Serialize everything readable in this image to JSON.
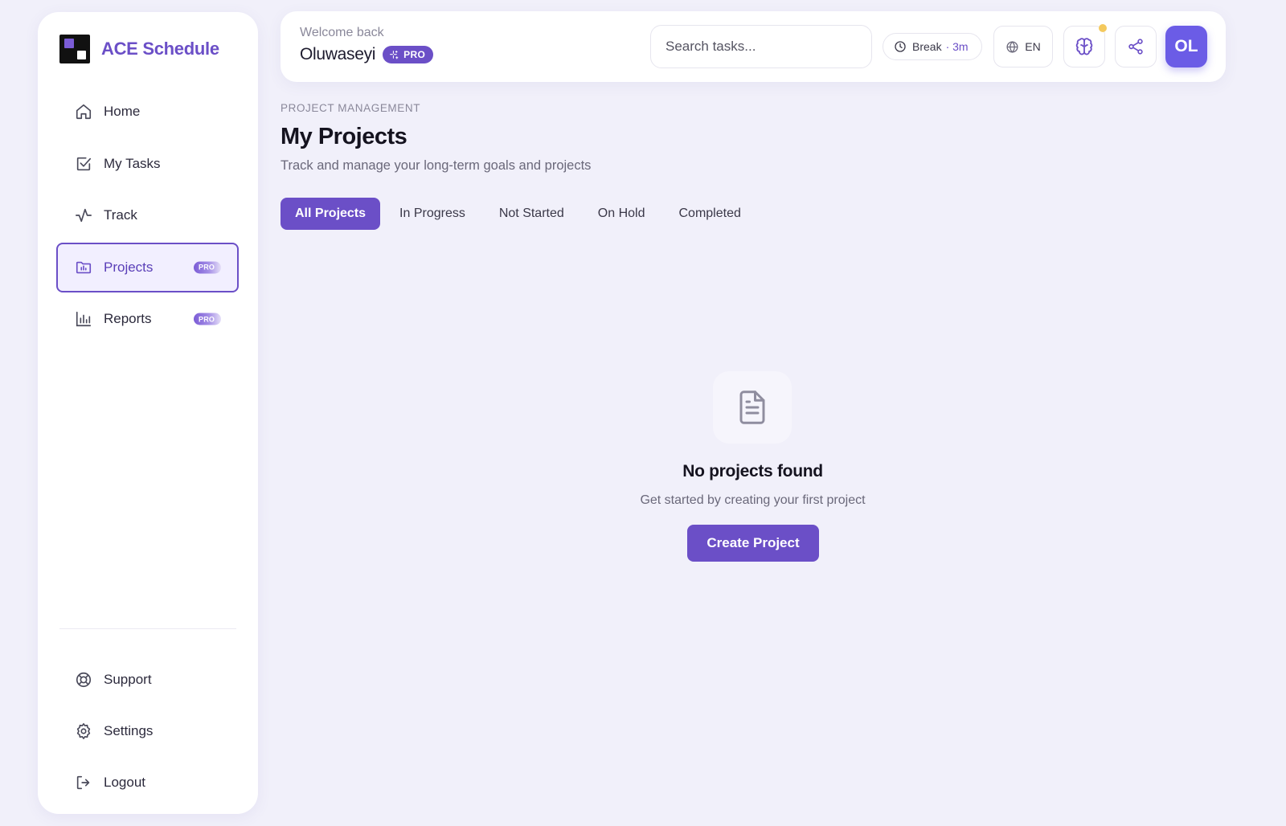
{
  "brand": {
    "name": "ACE Schedule"
  },
  "sidebar": {
    "items": [
      {
        "label": "Home",
        "icon": "home-icon",
        "active": false,
        "pro": false
      },
      {
        "label": "My Tasks",
        "icon": "task-check-icon",
        "active": false,
        "pro": false
      },
      {
        "label": "Track",
        "icon": "activity-icon",
        "active": false,
        "pro": false
      },
      {
        "label": "Projects",
        "icon": "folder-chart-icon",
        "active": true,
        "pro": true,
        "badge": "PRO"
      },
      {
        "label": "Reports",
        "icon": "bar-chart-icon",
        "active": false,
        "pro": true,
        "badge": "PRO"
      }
    ],
    "bottom_items": [
      {
        "label": "Support",
        "icon": "lifebuoy-icon"
      },
      {
        "label": "Settings",
        "icon": "gear-icon"
      },
      {
        "label": "Logout",
        "icon": "logout-icon"
      }
    ]
  },
  "header": {
    "welcome": "Welcome back",
    "username": "Oluwaseyi",
    "pro_badge": "PRO",
    "search": {
      "placeholder": "Search tasks...",
      "value": ""
    },
    "break_label": "Break",
    "break_duration": "· 3m",
    "language": "EN",
    "avatar_initials": "OL"
  },
  "main": {
    "kicker": "PROJECT MANAGEMENT",
    "title": "My Projects",
    "subtitle": "Track and manage your long-term goals and projects",
    "tabs": [
      {
        "label": "All Projects",
        "active": true
      },
      {
        "label": "In Progress",
        "active": false
      },
      {
        "label": "Not Started",
        "active": false
      },
      {
        "label": "On Hold",
        "active": false
      },
      {
        "label": "Completed",
        "active": false
      }
    ],
    "empty": {
      "title": "No projects found",
      "subtitle": "Get started by creating your first project",
      "button": "Create Project",
      "icon": "document-icon"
    }
  },
  "colors": {
    "accent": "#6b4fc7",
    "avatar": "#6b5ce6",
    "notification": "#f4c95d",
    "background": "#f1f0fa"
  }
}
